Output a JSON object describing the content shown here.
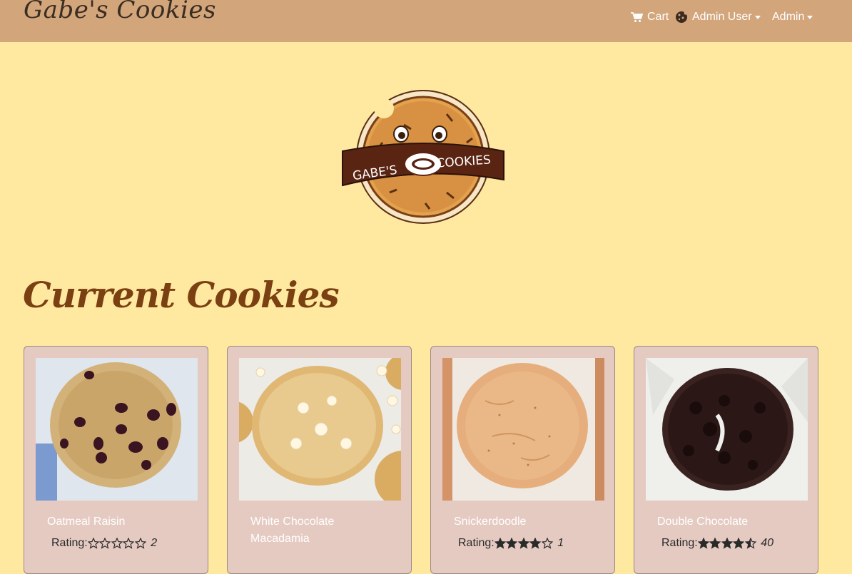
{
  "brand": "Gabe's Cookies",
  "nav": {
    "cart_label": "Cart",
    "user_label": "Admin User",
    "admin_label": "Admin"
  },
  "hero": {
    "logo_text_left": "GABE'S",
    "logo_text_right": "COOKIES"
  },
  "section_title": "Current Cookies",
  "rating_label": "Rating:",
  "cookies": [
    {
      "name": "Oatmeal Raisin",
      "rating": 0,
      "count": "2"
    },
    {
      "name": "White Chocolate Macadamia",
      "rating": null,
      "count": ""
    },
    {
      "name": "Snickerdoodle",
      "rating": 4,
      "count": "1"
    },
    {
      "name": "Double Chocolate",
      "rating": 4.5,
      "count": "40"
    }
  ],
  "colors": {
    "navbar": "#d3a57b",
    "page_bg": "#ffe9a1",
    "card_bg": "#e5cac2",
    "heading": "#7a4012"
  }
}
